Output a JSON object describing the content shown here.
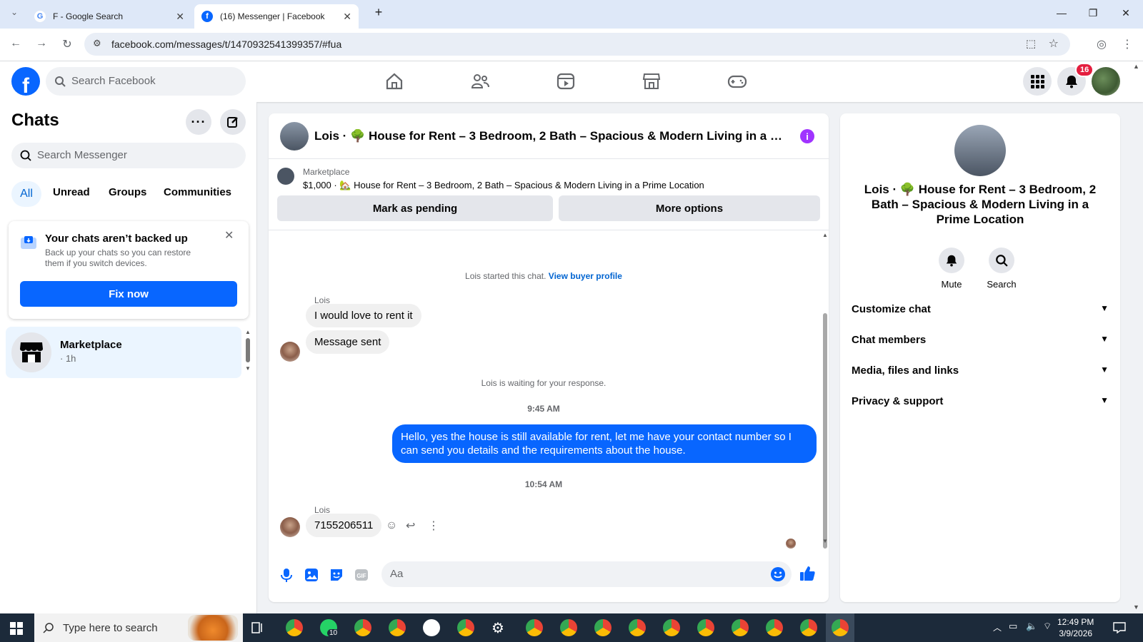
{
  "browser": {
    "tabs": [
      {
        "title": "F - Google Search",
        "active": false
      },
      {
        "title": "(16) Messenger | Facebook",
        "active": true
      }
    ],
    "url": "facebook.com/messages/t/1470932541399357/#fua"
  },
  "fb": {
    "search_placeholder": "Search Facebook",
    "notification_count": "16"
  },
  "sidebar": {
    "title": "Chats",
    "search_placeholder": "Search Messenger",
    "filters": [
      "All",
      "Unread",
      "Groups",
      "Communities"
    ],
    "backup": {
      "title": "Your chats aren’t backed up",
      "desc": "Back up your chats so you can restore them if you switch devices.",
      "button": "Fix now"
    },
    "chat_item": {
      "name": "Marketplace",
      "time": "· 1h"
    }
  },
  "chat": {
    "header_title": "Lois · 🌳 House for Rent – 3 Bedroom, 2 Bath – Spacious & Modern Living in a Prime Location",
    "marketplace_label": "Marketplace",
    "listing": "$1,000 · 🏡 House for Rent – 3 Bedroom, 2 Bath – Spacious & Modern Living in a Prime Location",
    "btn_pending": "Mark as pending",
    "btn_more": "More options",
    "started": "Lois started this chat.",
    "view_profile": "View buyer profile",
    "sender": "Lois",
    "msg1": "I would love to rent it",
    "msg2": "Message sent",
    "waiting": "Lois is waiting for your response.",
    "time1": "9:45 AM",
    "out_msg": "Hello, yes the house is still available for rent, let me have your contact number so I can send you details and the requirements about the house.",
    "time2": "10:54 AM",
    "msg3": "7155206511",
    "input_placeholder": "Aa"
  },
  "details": {
    "title": "Lois · 🌳 House for Rent – 3 Bedroom, 2 Bath – Spacious & Modern Living in a Prime Location",
    "mute": "Mute",
    "search": "Search",
    "sections": [
      "Customize chat",
      "Chat members",
      "Media, files and links",
      "Privacy & support"
    ]
  },
  "taskbar": {
    "search_placeholder": "Type here to search",
    "whatsapp_badge": "10",
    "time": "12:49 PM",
    "date": "3/9/2026"
  },
  "colors": {
    "fb_blue": "#0866ff",
    "accent_purple": "#a033ff"
  }
}
